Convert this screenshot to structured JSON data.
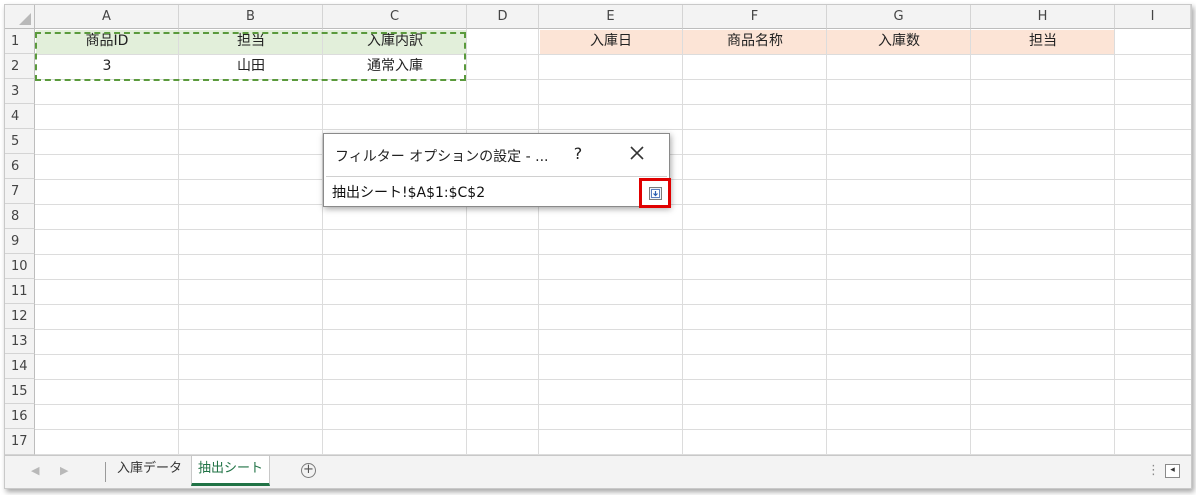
{
  "columns": [
    "A",
    "B",
    "C",
    "D",
    "E",
    "F",
    "G",
    "H",
    "I"
  ],
  "rows": [
    "1",
    "2",
    "3",
    "4",
    "5",
    "6",
    "7",
    "8",
    "9",
    "10",
    "11",
    "12",
    "13",
    "14",
    "15",
    "16",
    "17"
  ],
  "cells": {
    "A1": "商品ID",
    "B1": "担当",
    "C1": "入庫内訳",
    "A2": "3",
    "B2": "山田",
    "C2": "通常入庫",
    "E1": "入庫日",
    "F1": "商品名称",
    "G1": "入庫数",
    "H1": "担当"
  },
  "colors": {
    "criteria_header_fill": "#e2efda",
    "output_header_fill": "#fce4d6",
    "marquee": "#5a9a3c",
    "highlight_border": "#e00000",
    "active_tab": "#217346"
  },
  "dialog": {
    "title": "フィルター オプションの設定 - ...",
    "help": "?",
    "range_value": "抽出シート!$A$1:$C$2",
    "collapse_icon": "collapse-dialog-icon"
  },
  "tabs": [
    {
      "label": "入庫データ",
      "active": false
    },
    {
      "label": "抽出シート",
      "active": true
    }
  ],
  "tabbar": {
    "nav_prev": "◀",
    "nav_next": "▶",
    "add_label": "+",
    "more": "⋮",
    "scroll_left": "◂"
  }
}
